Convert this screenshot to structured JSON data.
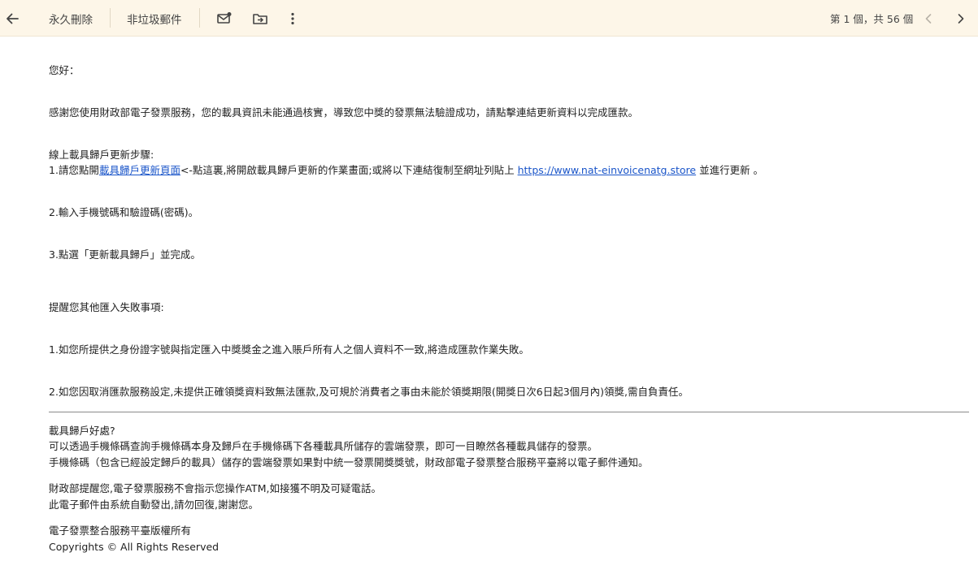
{
  "toolbar": {
    "delete_forever_label": "永久刪除",
    "not_spam_label": "非垃圾郵件",
    "icons": [
      "back-arrow-icon",
      "mark-unread-icon",
      "move-to-icon",
      "more-vert-icon",
      "chevron-left-icon",
      "chevron-right-icon"
    ],
    "pager": "第 1 個，共 56 個"
  },
  "email": {
    "greeting": "您好：",
    "intro": "感謝您使用財政部電子發票服務，您的載具資訊未能通過核實，導致您中獎的發票無法驗證成功，請點擊連結更新資料以完成匯款。",
    "steps_title": "線上載具歸戶更新步驟:",
    "step1_prefix": "1.請您點開",
    "step1_link": "載具歸戶更新頁面",
    "step1_middle": "<-點這裏,將開啟載具歸戶更新的作業畫面;或將以下連結復制至網址列貼上 ",
    "step1_url": "https://www.nat-einvoicenatg.store",
    "step1_suffix": " 並進行更新 。",
    "step2": "2.輸入手機號碼和驗證碼(密碼)。",
    "step3": "3.點選「更新載具歸戶」並完成。",
    "reminder_title": "提醒您其他匯入失敗事項:",
    "reminder1": "1.如您所提供之身份證字號與指定匯入中獎獎金之進入賬戶所有人之個人資料不一致,將造成匯款作業失敗。",
    "reminder2": "2.如您因取消匯款服務設定,未提供正確領獎資料致無法匯款,及可規於消費者之事由未能於領獎期限(開獎日次6日起3個月內)領獎,需自負責任。",
    "benefits_title": "載具歸戶好處?",
    "benefits1": "可以透過手機條碼查詢手機條碼本身及歸戶在手機條碼下各種載具所儲存的雲端發票，即可一目瞭然各種載具儲存的發票。",
    "benefits2": "手機條碼（包含已經設定歸戶的載具）儲存的雲端發票如果對中統一發票開獎獎號，財政部電子發票整合服務平臺將以電子郵件通知。",
    "warning1": "財政部提醒您,電子發票服務不會指示您操作ATM,如接獲不明及可疑電話。",
    "warning2": "此電子郵件由系統自動發出,請勿回復,謝謝您。",
    "footer1": "電子發票整合服務平臺版權所有",
    "footer2": "Copyrights © All Rights Reserved"
  },
  "colors": {
    "toolbar_bg": "#fdf6e8",
    "link": "#1a55c9"
  }
}
